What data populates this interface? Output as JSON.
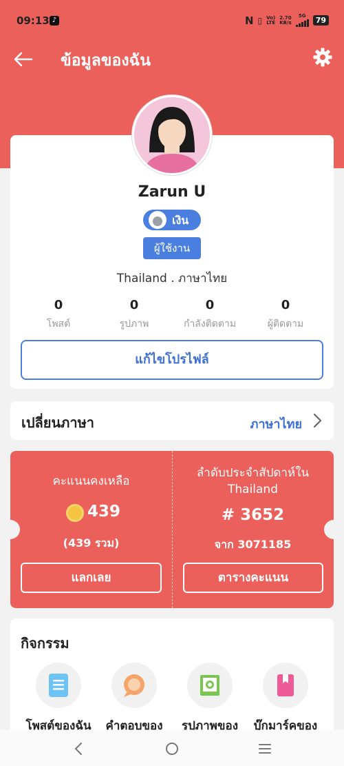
{
  "status_bar": {
    "time": "09:13",
    "net_speed": "2.70",
    "net_unit": "KB/s",
    "volte": "Vo)",
    "lte": "LTE",
    "network": "5G",
    "battery": "79"
  },
  "topbar": {
    "title": "ข้อมูลของฉัน"
  },
  "profile": {
    "name": "Zarun U",
    "level_badge": "เงิน",
    "role_badge": "ผู้ใช้งาน",
    "location": "Thailand . ภาษาไทย",
    "stats": [
      {
        "value": "0",
        "label": "โพสต์"
      },
      {
        "value": "0",
        "label": "รูปภาพ"
      },
      {
        "value": "0",
        "label": "กำลังติดตาม"
      },
      {
        "value": "0",
        "label": "ผู้ติดตาม"
      }
    ],
    "edit_button": "แก้ไขโปรไฟล์"
  },
  "language": {
    "label": "เปลี่ยนภาษา",
    "value": "ภาษาไทย"
  },
  "points": {
    "left_title": "คะแนนคงเหลือ",
    "balance": "439",
    "total": "(439 รวม)",
    "redeem_button": "แลกเลย",
    "right_title_line1": "ลำดับประจำสัปดาห์ใน",
    "right_title_line2": "Thailand",
    "rank": "# 3652",
    "rank_of": "จาก 3071185",
    "leaderboard_button": "ตารางคะแนน"
  },
  "activity": {
    "title": "กิจกรรม",
    "items": [
      {
        "label": "โพสต์ของฉัน",
        "icon": "document-icon"
      },
      {
        "label": "คำตอบของ",
        "icon": "chat-bubble-icon"
      },
      {
        "label": "รูปภาพของ",
        "icon": "photo-icon"
      },
      {
        "label": "บุ๊กมาร์คของ",
        "icon": "bookmark-icon"
      }
    ]
  }
}
